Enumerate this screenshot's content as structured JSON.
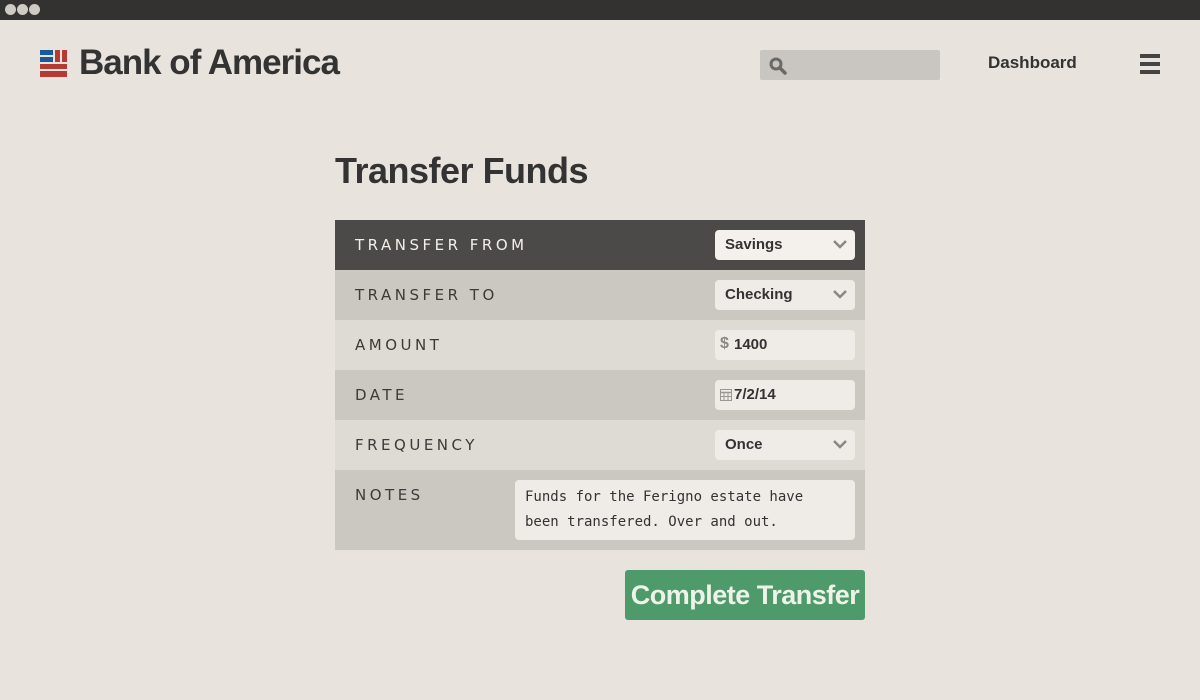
{
  "brand": {
    "name": "Bank of America",
    "colors": {
      "blue": "#1a5a96",
      "red": "#b33b34"
    }
  },
  "header": {
    "search": {
      "placeholder": "",
      "value": ""
    },
    "dashboard_label": "Dashboard"
  },
  "main": {
    "title": "Transfer Funds",
    "fields": {
      "transfer_from": {
        "label": "TRANSFER FROM",
        "value": "Savings"
      },
      "transfer_to": {
        "label": "TRANSFER TO",
        "value": "Checking"
      },
      "amount": {
        "label": "AMOUNT",
        "currency_symbol": "$",
        "value": "1400"
      },
      "date": {
        "label": "DATE",
        "value": "7/2/14"
      },
      "frequency": {
        "label": "FREQUENCY",
        "value": "Once"
      },
      "notes": {
        "label": "NOTES",
        "value": "Funds for the Ferigno estate have been transfered. Over and out."
      }
    },
    "submit_label": "Complete Transfer",
    "colors": {
      "active_row": "#4b4a48",
      "submit": "#4e9a6a"
    }
  }
}
